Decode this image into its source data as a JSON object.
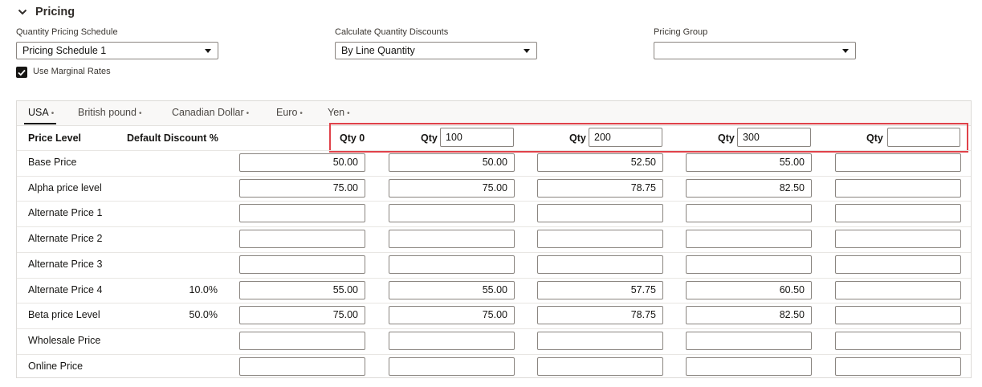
{
  "section": {
    "title": "Pricing"
  },
  "fields": {
    "qty_schedule": {
      "label": "Quantity Pricing Schedule",
      "value": "Pricing Schedule 1"
    },
    "calc_discounts": {
      "label": "Calculate Quantity Discounts",
      "value": "By Line Quantity"
    },
    "pricing_group": {
      "label": "Pricing Group",
      "value": ""
    },
    "marginal": {
      "label": "Use Marginal Rates",
      "checked": true
    }
  },
  "tabs": [
    {
      "label": "USA",
      "dot": "•",
      "active": true
    },
    {
      "label": "British pound",
      "dot": "•"
    },
    {
      "label": "Canadian Dollar",
      "dot": "•"
    },
    {
      "label": "Euro",
      "dot": "•"
    },
    {
      "label": "Yen",
      "dot": "•"
    }
  ],
  "table": {
    "col_price_level": "Price Level",
    "col_default_discount": "Default Discount %",
    "qty_label": "Qty",
    "qty0_label": "Qty 0",
    "qty_values": [
      "100",
      "200",
      "300",
      ""
    ],
    "rows": [
      {
        "label": "Base Price",
        "discount": "",
        "prices": [
          "50.00",
          "50.00",
          "52.50",
          "55.00",
          ""
        ]
      },
      {
        "label": "Alpha price level",
        "discount": "",
        "prices": [
          "75.00",
          "75.00",
          "78.75",
          "82.50",
          ""
        ]
      },
      {
        "label": "Alternate Price 1",
        "discount": "",
        "prices": [
          "",
          "",
          "",
          "",
          ""
        ]
      },
      {
        "label": "Alternate Price 2",
        "discount": "",
        "prices": [
          "",
          "",
          "",
          "",
          ""
        ]
      },
      {
        "label": "Alternate Price 3",
        "discount": "",
        "prices": [
          "",
          "",
          "",
          "",
          ""
        ]
      },
      {
        "label": "Alternate Price 4",
        "discount": "10.0%",
        "prices": [
          "55.00",
          "55.00",
          "57.75",
          "60.50",
          ""
        ]
      },
      {
        "label": "Beta price Level",
        "discount": "50.0%",
        "prices": [
          "75.00",
          "75.00",
          "78.75",
          "82.50",
          ""
        ]
      },
      {
        "label": "Wholesale Price",
        "discount": "",
        "prices": [
          "",
          "",
          "",
          "",
          ""
        ]
      },
      {
        "label": "Online Price",
        "discount": "",
        "prices": [
          "",
          "",
          "",
          "",
          ""
        ]
      }
    ]
  },
  "colors": {
    "highlight": "#e0424a",
    "border": "#8a8580",
    "text": "#161513"
  },
  "icons": {
    "collapse": "chevron-down-icon",
    "check": "checkmark-icon",
    "dropdown": "caret-down-icon"
  }
}
